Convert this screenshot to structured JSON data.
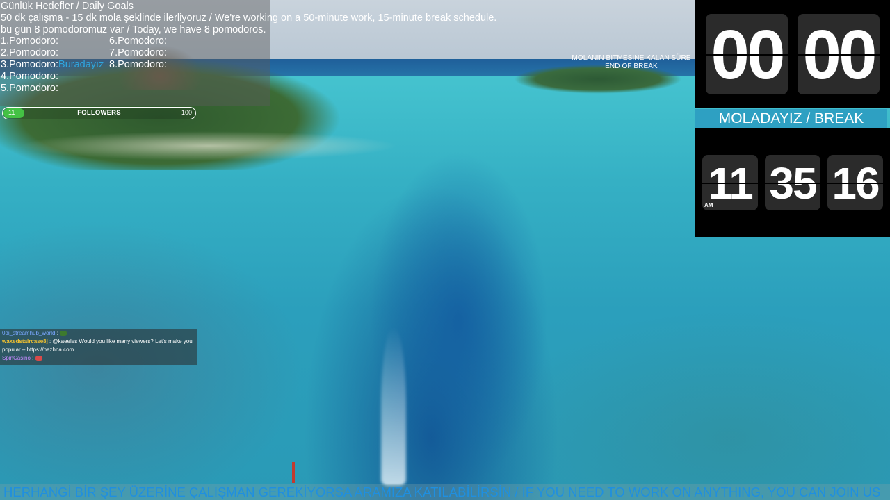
{
  "goals": {
    "title": "Günlük Hedefler / Daily Goals",
    "schedule": "50 dk çalışma - 15 dk mola şeklinde ilerliyoruz / We're working on a 50-minute work, 15-minute break schedule.",
    "count_line": "bu gün 8 pomodoromuz var / Today, we have 8 pomodoros.",
    "left": [
      "1.Pomodoro:",
      "2.Pomodoro:",
      "3.Pomodoro:",
      "4.Pomodoro:",
      "5.Pomodoro:"
    ],
    "current_marker": "Buradayız",
    "right": [
      "6.Pomodoro:",
      "7.Pomodoro:",
      "8.Pomodoro:"
    ]
  },
  "followers": {
    "current": "11",
    "label": "FOLLOWERS",
    "goal": "100",
    "progress_fraction": 0.11,
    "fill_color": "#44c144"
  },
  "break_label": {
    "line1": "MOLANIN BITMESINE KALAN SÜRE",
    "line2": "END OF BREAK"
  },
  "timer": {
    "minutes": "00",
    "seconds": "00"
  },
  "mode_banner": {
    "text": "MOLADAYIZ / BREAK",
    "color": "#2ea0c2"
  },
  "clock": {
    "hours": "11",
    "minutes": "35",
    "seconds": "16",
    "ampm": "AM"
  },
  "chat": [
    {
      "user": "0di_streamhub_world",
      "sep": " : ",
      "message": "",
      "emote": "frog-emote"
    },
    {
      "user": "waxedstaircase8j",
      "sep": " : ",
      "message": "@kaeeles Would you like many viewers? Let's make you popular – https://nezhna.com"
    },
    {
      "user": "SpinCasino",
      "sep": " : ",
      "message": "",
      "emote": "heart-emote"
    }
  ],
  "ticker": {
    "text": "HERHANGİ BİR ŞEY ÜZERİNE ÇALIŞMAN GEREKİYORSA ARAMIZA KATILABİLİRSİN / IF YOU NEED TO WORK ON ANYTHING, YOU CAN JOIN US",
    "color": "#1f8fe0"
  }
}
